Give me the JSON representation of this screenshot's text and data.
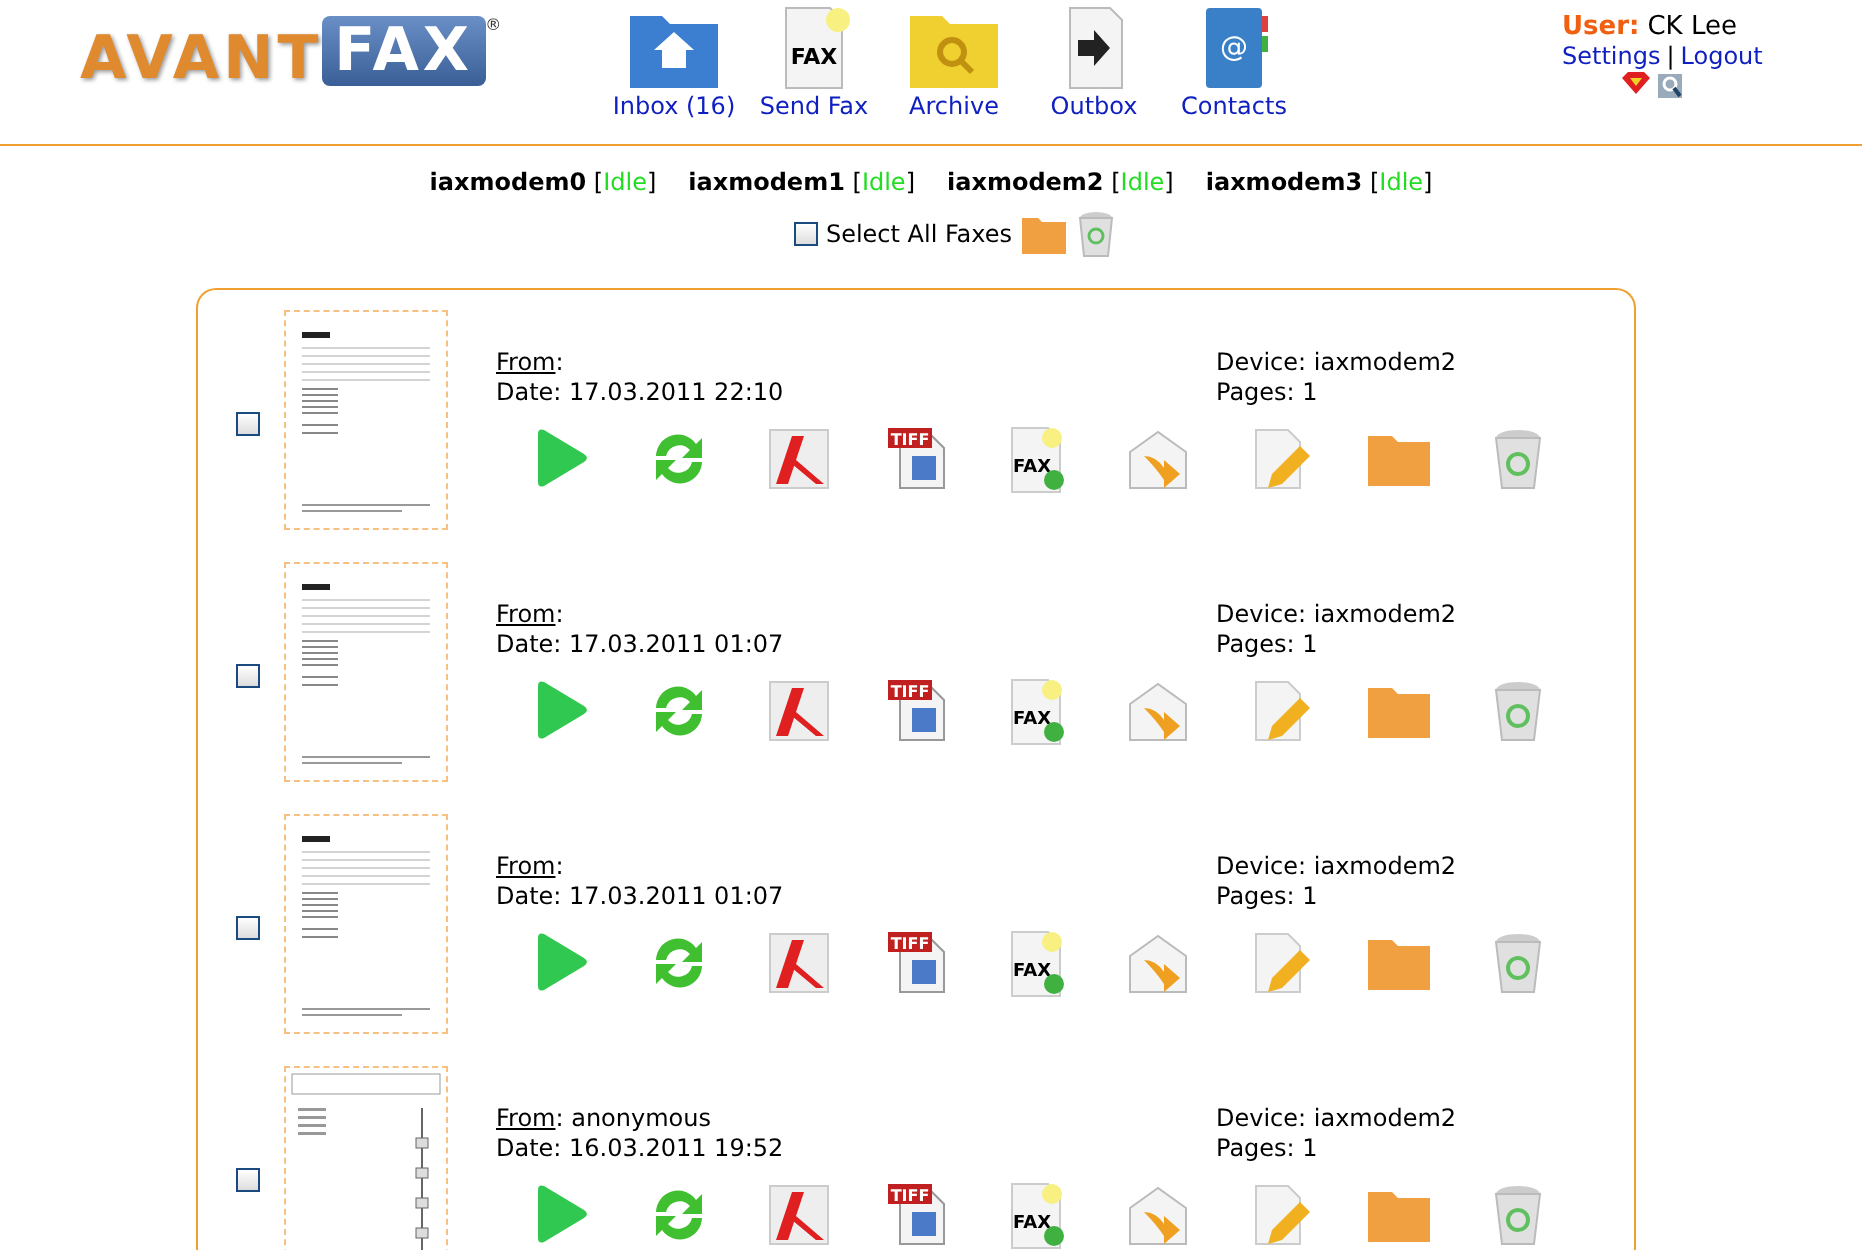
{
  "logo": {
    "part_1": "AVANT",
    "part_2": "FAX",
    "mark": "®"
  },
  "nav": [
    {
      "kind": "inbox",
      "label": "Inbox (16)"
    },
    {
      "kind": "send",
      "label": "Send Fax",
      "icon_text": "FAX"
    },
    {
      "kind": "archive",
      "label": "Archive"
    },
    {
      "kind": "outbox",
      "label": "Outbox"
    },
    {
      "kind": "contacts",
      "label": "Contacts",
      "icon_text": "@"
    }
  ],
  "user": {
    "label": "User:",
    "name": "CK Lee",
    "links": [
      "Settings",
      "Logout"
    ],
    "separator": "|"
  },
  "modems": [
    {
      "name": "iaxmodem0",
      "open": "[",
      "status": "Idle",
      "close": "]"
    },
    {
      "name": "iaxmodem1",
      "open": "[",
      "status": "Idle",
      "close": "]"
    },
    {
      "name": "iaxmodem2",
      "open": "[",
      "status": "Idle",
      "close": "]"
    },
    {
      "name": "iaxmodem3",
      "open": "[",
      "status": "Idle",
      "close": "]"
    }
  ],
  "select_all": {
    "label": "Select All Faxes",
    "checked": false
  },
  "faxes": [
    {
      "checked": false,
      "thumbnail": {
        "kind": "form"
      },
      "from_label": "From",
      "colon": ":",
      "date": "Date: 17.03.2011 22:10",
      "device": "Device: iaxmodem2",
      "pages": "Pages: 1",
      "actions": [
        {
          "kind": "view"
        },
        {
          "kind": "refresh"
        },
        {
          "kind": "pdf"
        },
        {
          "kind": "tiff",
          "text": "TIFF"
        },
        {
          "kind": "fax",
          "text": "FAX"
        },
        {
          "kind": "forward"
        },
        {
          "kind": "edit"
        },
        {
          "kind": "folder"
        },
        {
          "kind": "trash"
        }
      ]
    },
    {
      "checked": false,
      "thumbnail": {
        "kind": "form"
      },
      "from_label": "From",
      "colon": ":",
      "date": "Date: 17.03.2011 01:07",
      "device": "Device: iaxmodem2",
      "pages": "Pages: 1",
      "actions": [
        {
          "kind": "view"
        },
        {
          "kind": "refresh"
        },
        {
          "kind": "pdf"
        },
        {
          "kind": "tiff",
          "text": "TIFF"
        },
        {
          "kind": "fax",
          "text": "FAX"
        },
        {
          "kind": "forward"
        },
        {
          "kind": "edit"
        },
        {
          "kind": "folder"
        },
        {
          "kind": "trash"
        }
      ]
    },
    {
      "checked": false,
      "thumbnail": {
        "kind": "form"
      },
      "from_label": "From",
      "colon": ":",
      "date": "Date: 17.03.2011 01:07",
      "device": "Device: iaxmodem2",
      "pages": "Pages: 1",
      "actions": [
        {
          "kind": "view"
        },
        {
          "kind": "refresh"
        },
        {
          "kind": "pdf"
        },
        {
          "kind": "tiff",
          "text": "TIFF"
        },
        {
          "kind": "fax",
          "text": "FAX"
        },
        {
          "kind": "forward"
        },
        {
          "kind": "edit"
        },
        {
          "kind": "folder"
        },
        {
          "kind": "trash"
        }
      ]
    },
    {
      "checked": false,
      "thumbnail": {
        "kind": "diagram"
      },
      "from_label": "From",
      "colon": ":",
      "from": "anonymous",
      "date": "Date: 16.03.2011 19:52",
      "device": "Device: iaxmodem2",
      "pages": "Pages: 1",
      "actions": [
        {
          "kind": "view"
        },
        {
          "kind": "refresh"
        },
        {
          "kind": "pdf"
        },
        {
          "kind": "tiff",
          "text": "TIFF"
        },
        {
          "kind": "fax",
          "text": "FAX"
        },
        {
          "kind": "forward"
        },
        {
          "kind": "edit"
        },
        {
          "kind": "folder"
        },
        {
          "kind": "trash"
        }
      ]
    }
  ]
}
